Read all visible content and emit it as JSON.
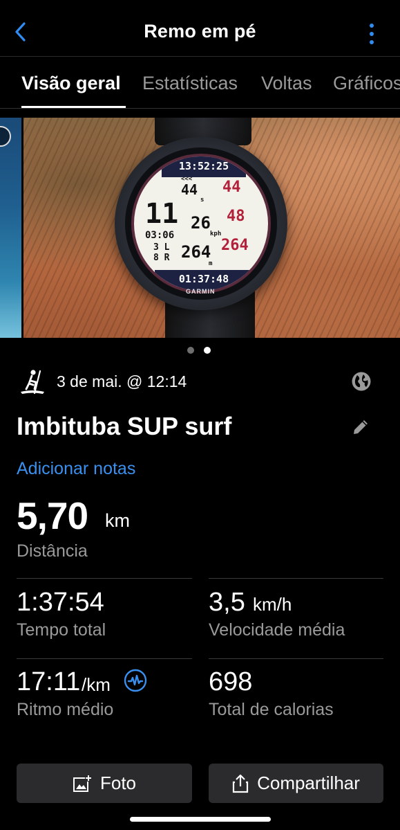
{
  "header": {
    "title": "Remo em pé",
    "back_icon": "chevron-left-icon",
    "more_icon": "vertical-dots-icon",
    "accent_color": "#2f8cf0"
  },
  "tabs": [
    {
      "label": "Visão geral",
      "active": true
    },
    {
      "label": "Estatísticas",
      "active": false
    },
    {
      "label": "Voltas",
      "active": false
    },
    {
      "label": "Gráficos",
      "active": false
    }
  ],
  "photo": {
    "watch_face": {
      "clock": "13:52:25",
      "arrows": "<<<",
      "left_big": "11",
      "top_mid": "44",
      "top_mid_unit": "s",
      "top_right": "44",
      "time_small": "03:06",
      "mid": "26",
      "mid_unit": "kph",
      "mid_right": "48",
      "strokes_left": "3 L",
      "strokes_right": "8 R",
      "bottom_mid": "264",
      "bottom_mid_unit": "m",
      "bottom_right": "264",
      "elapsed": "01:37:48",
      "brand": "GARMIN"
    },
    "page_count": 2,
    "active_page": 2
  },
  "activity": {
    "type_icon": "stand-up-paddle-icon",
    "date": "3 de mai. @ 12:14",
    "privacy_icon": "globe-icon",
    "name": "Imbituba SUP surf",
    "edit_icon": "pencil-icon",
    "add_notes": "Adicionar notas"
  },
  "summary": {
    "distance": {
      "value": "5,70",
      "unit": "km",
      "label": "Distância"
    },
    "stats": [
      {
        "value": "1:37:54",
        "unit": "",
        "label": "Tempo total"
      },
      {
        "value": "3,5",
        "unit": "km/h",
        "label": "Velocidade média"
      },
      {
        "value": "17:11",
        "unit": "/km",
        "label": "Ritmo médio",
        "icon": "heart-rate-icon"
      },
      {
        "value": "698",
        "unit": "",
        "label": "Total de calorias"
      }
    ]
  },
  "actions": {
    "photo_label": "Foto",
    "photo_icon": "add-photo-icon",
    "share_label": "Compartilhar",
    "share_icon": "share-icon"
  }
}
